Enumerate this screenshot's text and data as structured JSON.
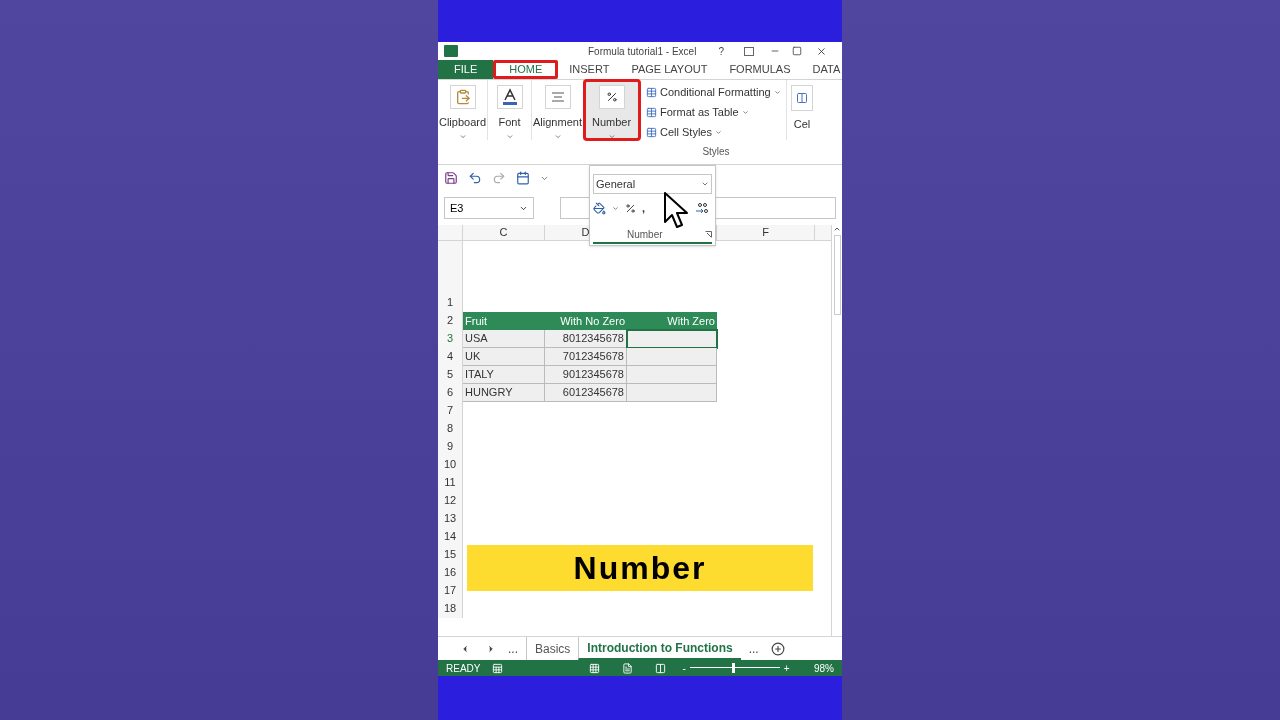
{
  "window": {
    "title": "Formula tutorial1 - Excel",
    "help": "?"
  },
  "ribbon_tabs": [
    {
      "label": "FILE",
      "kind": "file",
      "selected": false,
      "highlighted": false
    },
    {
      "label": "HOME",
      "kind": "tab",
      "selected": true,
      "highlighted": true
    },
    {
      "label": "INSERT",
      "kind": "tab",
      "selected": false,
      "highlighted": false
    },
    {
      "label": "PAGE LAYOUT",
      "kind": "tab",
      "selected": false,
      "highlighted": false
    },
    {
      "label": "FORMULAS",
      "kind": "tab",
      "selected": false,
      "highlighted": false
    },
    {
      "label": "DATA",
      "kind": "tab",
      "selected": false,
      "highlighted": false
    }
  ],
  "ribbon_groups": [
    {
      "label": "Clipboard",
      "kind": "clipboard",
      "highlighted": false
    },
    {
      "label": "Font",
      "kind": "font",
      "highlighted": false
    },
    {
      "label": "Alignment",
      "kind": "alignment",
      "highlighted": false
    },
    {
      "label": "Number",
      "kind": "number",
      "highlighted": true
    }
  ],
  "styles_group": {
    "items": [
      "Conditional Formatting",
      "Format as Table",
      "Cell Styles"
    ],
    "label": "Styles"
  },
  "cells_group": {
    "label": "Cel"
  },
  "name_box": "E3",
  "number_panel": {
    "format": "General",
    "comma": ",",
    "label": "Number"
  },
  "column_headers": [
    "C",
    "D",
    "F"
  ],
  "rows": [
    {
      "number": "1",
      "cells": []
    },
    {
      "number": "2",
      "kind": "header",
      "selected": false,
      "cells": [
        "Fruit",
        "With No Zero",
        "With  Zero"
      ]
    },
    {
      "number": "3",
      "kind": "data",
      "selected": true,
      "cells": [
        "USA",
        "8012345678",
        ""
      ]
    },
    {
      "number": "4",
      "kind": "data",
      "selected": false,
      "cells": [
        "UK",
        "7012345678",
        ""
      ]
    },
    {
      "number": "5",
      "kind": "data",
      "selected": false,
      "cells": [
        "ITALY",
        "9012345678",
        ""
      ]
    },
    {
      "number": "6",
      "kind": "data",
      "selected": false,
      "cells": [
        "HUNGRY",
        "6012345678",
        ""
      ]
    },
    {
      "number": "7",
      "cells": []
    },
    {
      "number": "8",
      "cells": []
    },
    {
      "number": "9",
      "cells": []
    },
    {
      "number": "10",
      "cells": []
    },
    {
      "number": "11",
      "cells": []
    },
    {
      "number": "12",
      "cells": []
    },
    {
      "number": "13",
      "cells": []
    },
    {
      "number": "14",
      "cells": []
    },
    {
      "number": "15",
      "cells": []
    },
    {
      "number": "16",
      "cells": []
    },
    {
      "number": "17",
      "cells": []
    },
    {
      "number": "18",
      "cells": []
    }
  ],
  "banner": "Number",
  "sheet_tabs": {
    "more_left": "...",
    "more_right": "...",
    "tabs": [
      {
        "label": "Basics",
        "selected": false
      },
      {
        "label": "Introduction to Functions",
        "selected": true
      }
    ]
  },
  "status_bar": {
    "status": "READY",
    "zoom_out": "-",
    "zoom_in": "+",
    "zoom": "98%",
    "level": 0.48
  }
}
